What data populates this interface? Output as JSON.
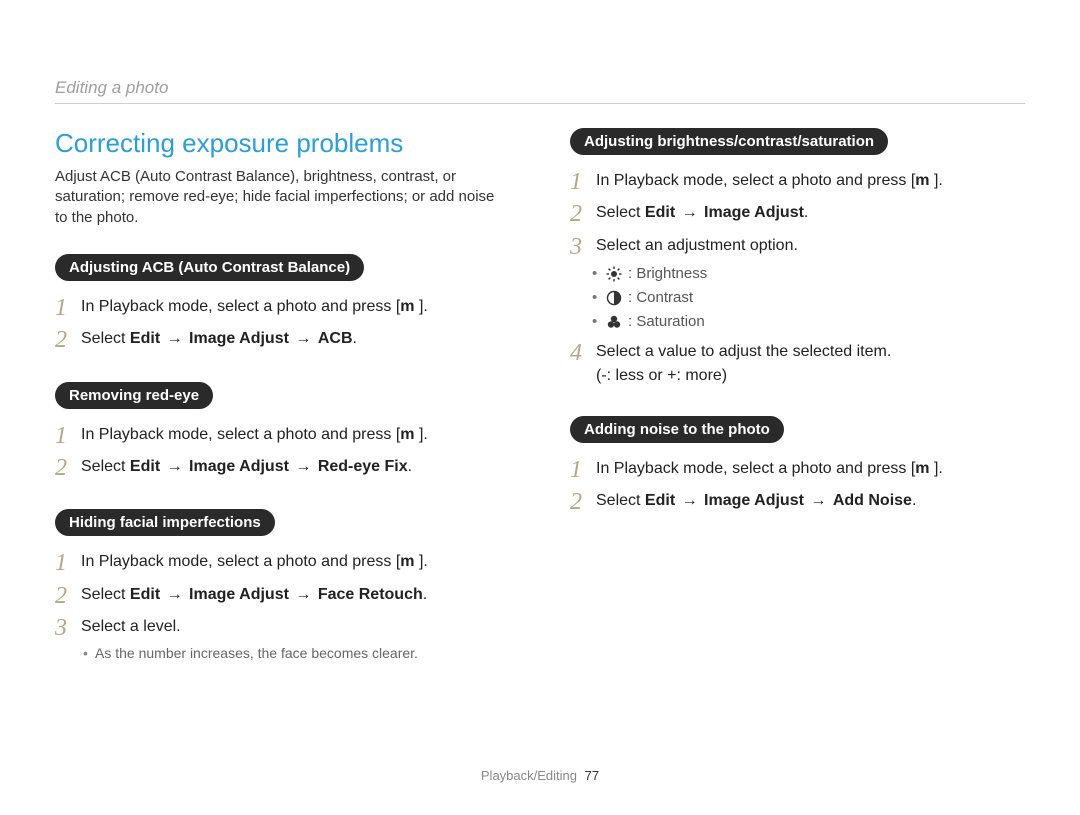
{
  "breadcrumb": "Editing a photo",
  "heading": "Correcting exposure problems",
  "intro": "Adjust ACB (Auto Contrast Balance), brightness, contrast, or saturation; remove red-eye; hide facial imperfections; or add noise to the photo.",
  "arrow": "→",
  "pills": {
    "acb": "Adjusting ACB (Auto Contrast Balance)",
    "redeye": "Removing red-eye",
    "facial": "Hiding facial imperfections",
    "bcs": "Adjusting brightness/contrast/saturation",
    "noise": "Adding noise to the photo"
  },
  "step_text": {
    "playback_prefix": "In Playback mode, select a photo and press [",
    "playback_m": "m",
    "playback_suffix": "      ].",
    "select": "Select ",
    "edit": "Edit",
    "image_adjust": "Image Adjust",
    "acb": "ACB",
    "redeye_fix": "Red-eye Fix",
    "face_retouch": "Face Retouch",
    "add_noise": "Add Noise",
    "period": ".",
    "select_level": "Select a level.",
    "select_adj": "Select an adjustment option.",
    "select_value": "Select a value to adjust the selected item.",
    "value_hint": "(-: less or +: more)"
  },
  "notes": {
    "face_clearer": "As the number increases, the face becomes clearer."
  },
  "options": {
    "brightness": ": Brightness",
    "contrast": ": Contrast",
    "saturation": ": Saturation"
  },
  "nums": {
    "n1": "1",
    "n2": "2",
    "n3": "3",
    "n4": "4"
  },
  "footer": {
    "section": "Playback/Editing",
    "page": "77"
  }
}
